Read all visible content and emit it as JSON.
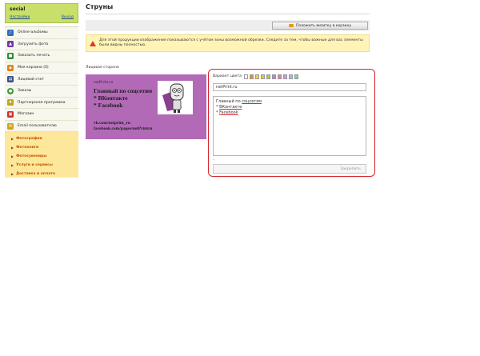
{
  "sidebar": {
    "username": "social",
    "settings_link": "Настройки",
    "logout_link": "Выход",
    "items": [
      {
        "label": "Online-альбомы",
        "icon": "albums-icon",
        "color": "#2d6fc1"
      },
      {
        "label": "Загрузить фото",
        "icon": "upload-icon",
        "color": "#6e3aa8"
      },
      {
        "label": "Заказать печать",
        "icon": "print-icon",
        "color": "#2f8a3a"
      },
      {
        "label": "Моя корзина (0)",
        "icon": "cart-icon",
        "color": "#e4861a"
      },
      {
        "label": "Лицевой счет",
        "icon": "account-icon",
        "color": "#3b4f8a"
      },
      {
        "label": "Заказы",
        "icon": "orders-icon",
        "color": "#3a9b30"
      },
      {
        "label": "Партнерская программа",
        "icon": "partner-icon",
        "color": "#c4a516"
      },
      {
        "label": "Магазин",
        "icon": "shop-icon",
        "color": "#d42f2f"
      },
      {
        "label": "Email пользователю",
        "icon": "email-icon",
        "color": "#d4a21a"
      }
    ],
    "submenu": [
      "Фотографии",
      "Фотокниги",
      "Фотосувениры",
      "Услуги и сервисы",
      "Доставка и оплата"
    ]
  },
  "main": {
    "title": "Струны",
    "cart_button": "Положить визитку в корзину",
    "warning": "Для этой продукции изображения показываются с учётом зоны возможной обрезки. Следите за тем, чтобы важные для вас элементы были видны полностью.",
    "side_label": "Лицевая сторона"
  },
  "card": {
    "brand": "netPrint.ru",
    "line1": "Главный по соцсетям",
    "line2": "* ВКонтакте",
    "line3": "* Facebook",
    "line4": "vk.com/netprint_ru",
    "line5": "facebook.com/pages/netPrintru"
  },
  "editor": {
    "color_label": "Вариант цвета",
    "swatches": [
      "#ffffff",
      "#f08a1e",
      "#f5d32a",
      "#e8c240",
      "#9fd04e",
      "#a58fd0",
      "#ef7aa0",
      "#c7a0e8",
      "#8ec8ea",
      "#73d4c4"
    ],
    "field_value": "netPrint.ru",
    "text_prefix": "Главный по ",
    "text_underlined": "соцсетям",
    "text_line2_prefix": "* ",
    "text_line2": "ВКонтакте",
    "text_line3_prefix": "* ",
    "text_line3": "Facebook",
    "dash": "-",
    "apply_button": "Закрепить"
  }
}
